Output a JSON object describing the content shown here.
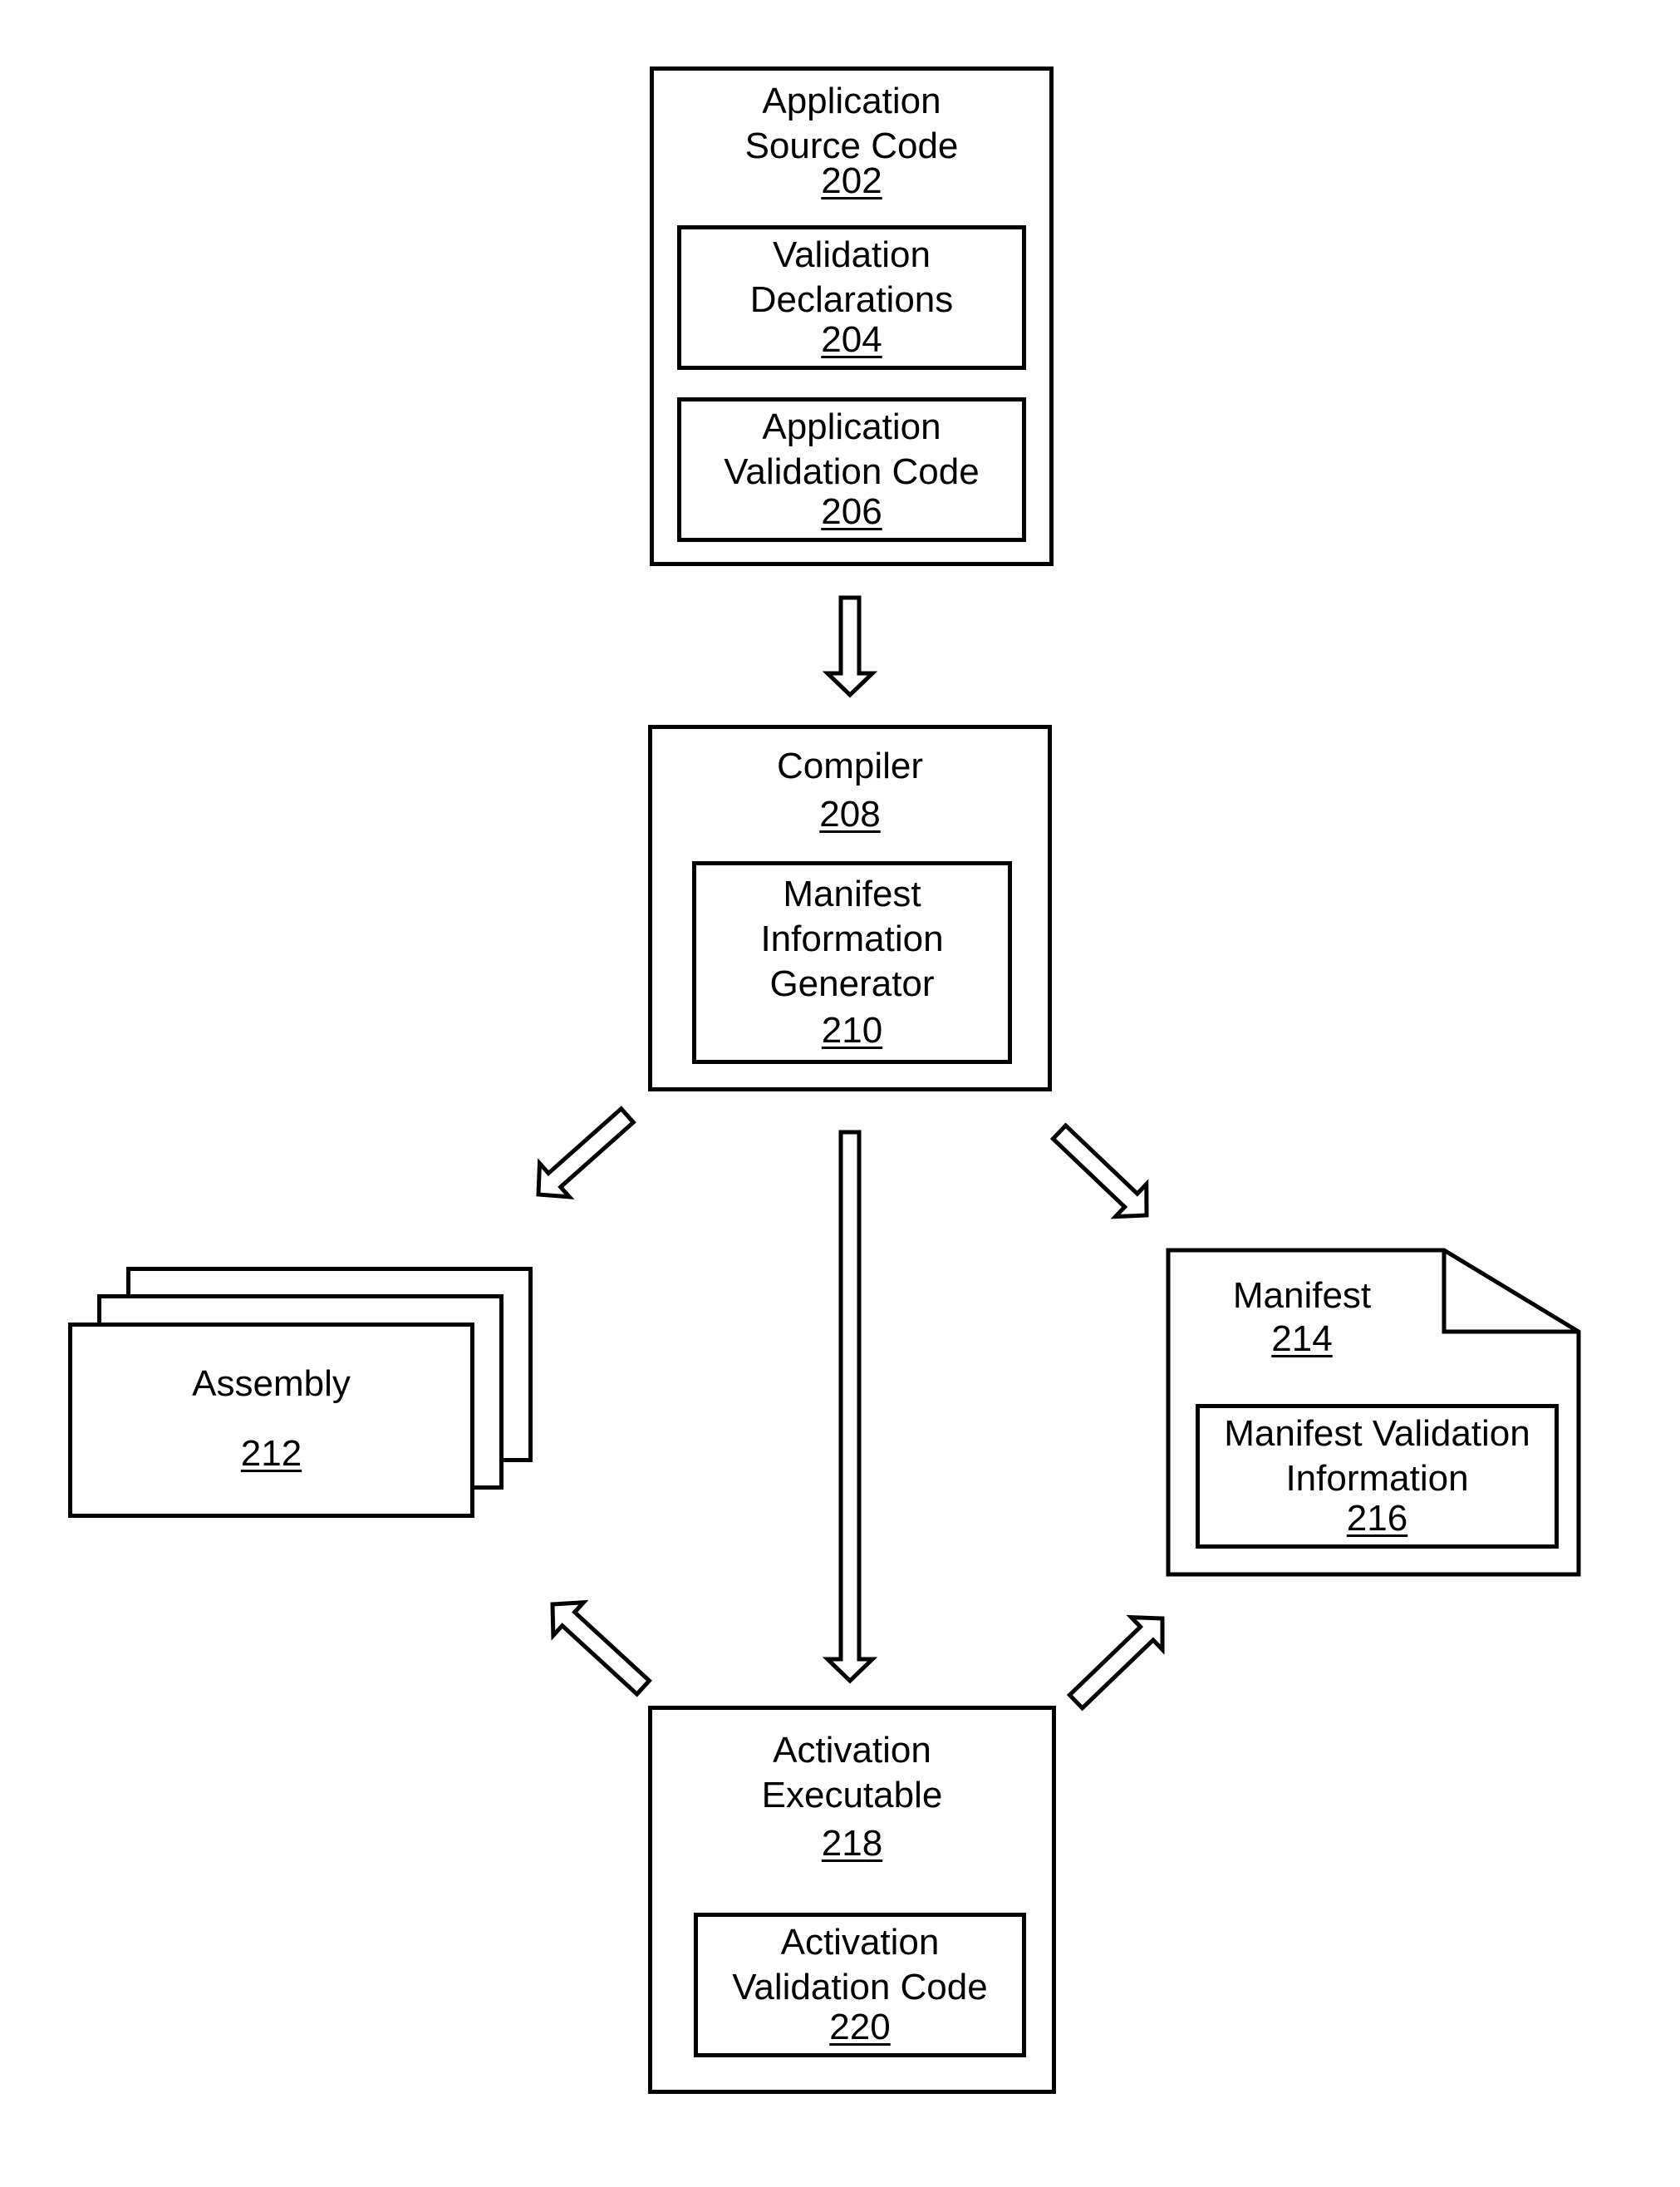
{
  "diagram": {
    "source_code": {
      "title_lines": [
        "Application",
        "Source Code"
      ],
      "ref": "202"
    },
    "validation_declarations": {
      "title_lines": [
        "Validation",
        "Declarations"
      ],
      "ref": "204"
    },
    "application_validation_code": {
      "title_lines": [
        "Application",
        "Validation Code"
      ],
      "ref": "206"
    },
    "compiler": {
      "title_lines": [
        "Compiler"
      ],
      "ref": "208"
    },
    "manifest_info_generator": {
      "title_lines": [
        "Manifest",
        "Information",
        "Generator"
      ],
      "ref": "210"
    },
    "assembly": {
      "title_lines": [
        "Assembly"
      ],
      "ref": "212"
    },
    "manifest": {
      "title_lines": [
        "Manifest"
      ],
      "ref": "214"
    },
    "manifest_validation_info": {
      "title_lines": [
        "Manifest Validation",
        "Information"
      ],
      "ref": "216"
    },
    "activation_executable": {
      "title_lines": [
        "Activation",
        "Executable"
      ],
      "ref": "218"
    },
    "activation_validation_code": {
      "title_lines": [
        "Activation",
        "Validation Code"
      ],
      "ref": "220"
    }
  },
  "arrows": [
    {
      "from": "source_code",
      "to": "compiler"
    },
    {
      "from": "compiler",
      "to": "assembly"
    },
    {
      "from": "compiler",
      "to": "manifest"
    },
    {
      "from": "compiler",
      "to": "activation_executable"
    },
    {
      "from": "activation_executable",
      "to": "assembly"
    },
    {
      "from": "activation_executable",
      "to": "manifest"
    }
  ]
}
